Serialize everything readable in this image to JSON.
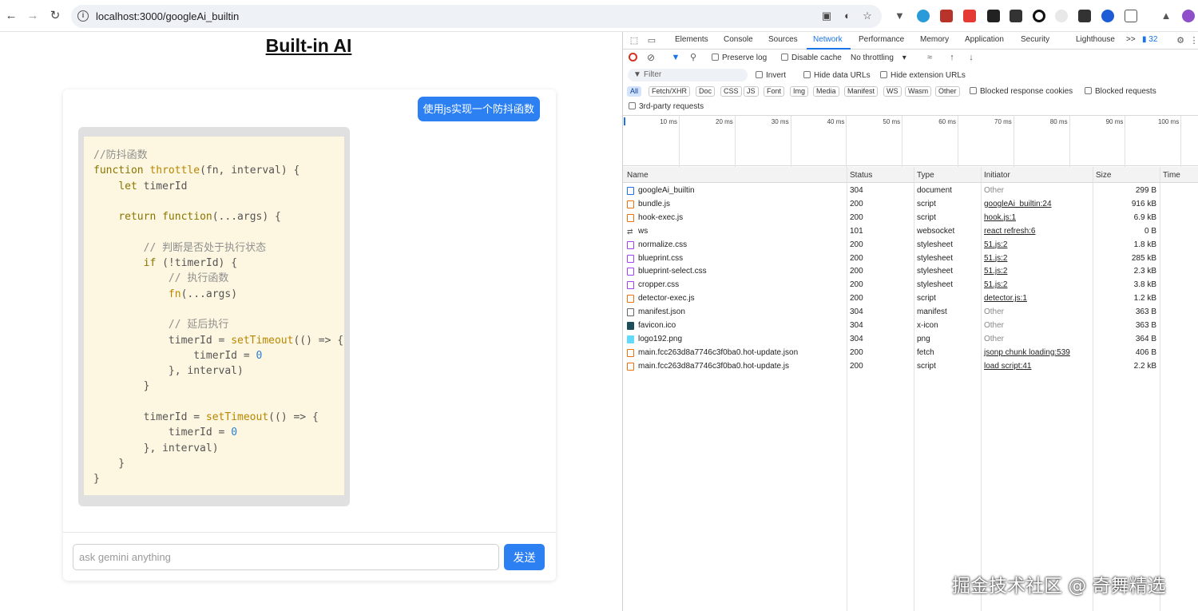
{
  "browser": {
    "url": "localhost:3000/googleAi_builtin",
    "back_icon": "arrow-left-icon",
    "forward_icon": "arrow-right-icon",
    "reload_icon": "reload-icon"
  },
  "page": {
    "title": "Built-in AI",
    "user_message": "使用js实现一个防抖函数",
    "input_placeholder": "ask gemini anything",
    "send_label": "发送"
  },
  "code_lines": [
    "//防抖函数",
    "function throttle(fn, interval) {",
    "    let timerId",
    "",
    "    return function(...args) {",
    "",
    "        // 判断是否处于执行状态",
    "        if (!timerId) {",
    "            // 执行函数",
    "            fn(...args)",
    "",
    "            // 延后执行",
    "            timerId = setTimeout(() => {",
    "                timerId = 0",
    "            }, interval)",
    "        }",
    "",
    "        timerId = setTimeout(() => {",
    "            timerId = 0",
    "        }, interval)",
    "    }",
    "}"
  ],
  "devtools": {
    "tabs": [
      "Elements",
      "Console",
      "Sources",
      "Network",
      "Performance",
      "Memory",
      "Application",
      "Security",
      "Lighthouse"
    ],
    "active_tab": "Network",
    "more_tabs": ">>",
    "issues_count": "32",
    "toolbar": {
      "preserve_log": "Preserve log",
      "disable_cache": "Disable cache",
      "throttling": "No throttling"
    },
    "filter": {
      "placeholder": "Filter",
      "invert": "Invert",
      "hide_data_urls": "Hide data URLs",
      "hide_extension_urls": "Hide extension URLs",
      "blocked_response_cookies": "Blocked response cookies",
      "blocked_requests": "Blocked requests",
      "third_party": "3rd-party requests"
    },
    "type_filters": [
      "All",
      "Fetch/XHR",
      "Doc",
      "CSS",
      "JS",
      "Font",
      "Img",
      "Media",
      "Manifest",
      "WS",
      "Wasm",
      "Other"
    ],
    "timeline_ticks": [
      "10 ms",
      "20 ms",
      "30 ms",
      "40 ms",
      "50 ms",
      "60 ms",
      "70 ms",
      "80 ms",
      "90 ms",
      "100 ms"
    ],
    "columns": [
      "Name",
      "Status",
      "Type",
      "Initiator",
      "Size",
      "Time"
    ],
    "requests": [
      {
        "name": "googleAi_builtin",
        "status": "304",
        "type": "document",
        "initiator": "Other",
        "size": "299 B",
        "kind": "doc",
        "color": "#1a73e8"
      },
      {
        "name": "bundle.js",
        "status": "200",
        "type": "script",
        "initiator": "googleAi_builtin:24",
        "size": "916 kB",
        "kind": "script",
        "color": "#e8710a"
      },
      {
        "name": "hook-exec.js",
        "status": "200",
        "type": "script",
        "initiator": "hook.js:1",
        "size": "6.9 kB",
        "kind": "script",
        "color": "#e8710a"
      },
      {
        "name": "ws",
        "status": "101",
        "type": "websocket",
        "initiator": "react refresh:6",
        "size": "0 B",
        "kind": "ws",
        "color": "#555555"
      },
      {
        "name": "normalize.css",
        "status": "200",
        "type": "stylesheet",
        "initiator": "51.js:2",
        "size": "1.8 kB",
        "kind": "css",
        "color": "#a142f4"
      },
      {
        "name": "blueprint.css",
        "status": "200",
        "type": "stylesheet",
        "initiator": "51.js:2",
        "size": "285 kB",
        "kind": "css",
        "color": "#a142f4"
      },
      {
        "name": "blueprint-select.css",
        "status": "200",
        "type": "stylesheet",
        "initiator": "51.js:2",
        "size": "2.3 kB",
        "kind": "css",
        "color": "#a142f4"
      },
      {
        "name": "cropper.css",
        "status": "200",
        "type": "stylesheet",
        "initiator": "51.js:2",
        "size": "3.8 kB",
        "kind": "css",
        "color": "#a142f4"
      },
      {
        "name": "detector-exec.js",
        "status": "200",
        "type": "script",
        "initiator": "detector.js:1",
        "size": "1.2 kB",
        "kind": "script",
        "color": "#e8710a"
      },
      {
        "name": "manifest.json",
        "status": "304",
        "type": "manifest",
        "initiator": "Other",
        "size": "363 B",
        "kind": "file",
        "color": "#666666"
      },
      {
        "name": "favicon.ico",
        "status": "304",
        "type": "x-icon",
        "initiator": "Other",
        "size": "363 B",
        "kind": "img",
        "color": "#1e4e5a"
      },
      {
        "name": "logo192.png",
        "status": "304",
        "type": "png",
        "initiator": "Other",
        "size": "364 B",
        "kind": "img",
        "color": "#61dafb"
      },
      {
        "name": "main.fcc263d8a7746c3f0ba0.hot-update.json",
        "status": "200",
        "type": "fetch",
        "initiator": "jsonp chunk loading:539",
        "size": "406 B",
        "kind": "fetch",
        "color": "#e8710a"
      },
      {
        "name": "main.fcc263d8a7746c3f0ba0.hot-update.js",
        "status": "200",
        "type": "script",
        "initiator": "load script:41",
        "size": "2.2 kB",
        "kind": "script",
        "color": "#e8710a"
      }
    ]
  },
  "watermark": "掘金技术社区 @ 奇舞精选"
}
